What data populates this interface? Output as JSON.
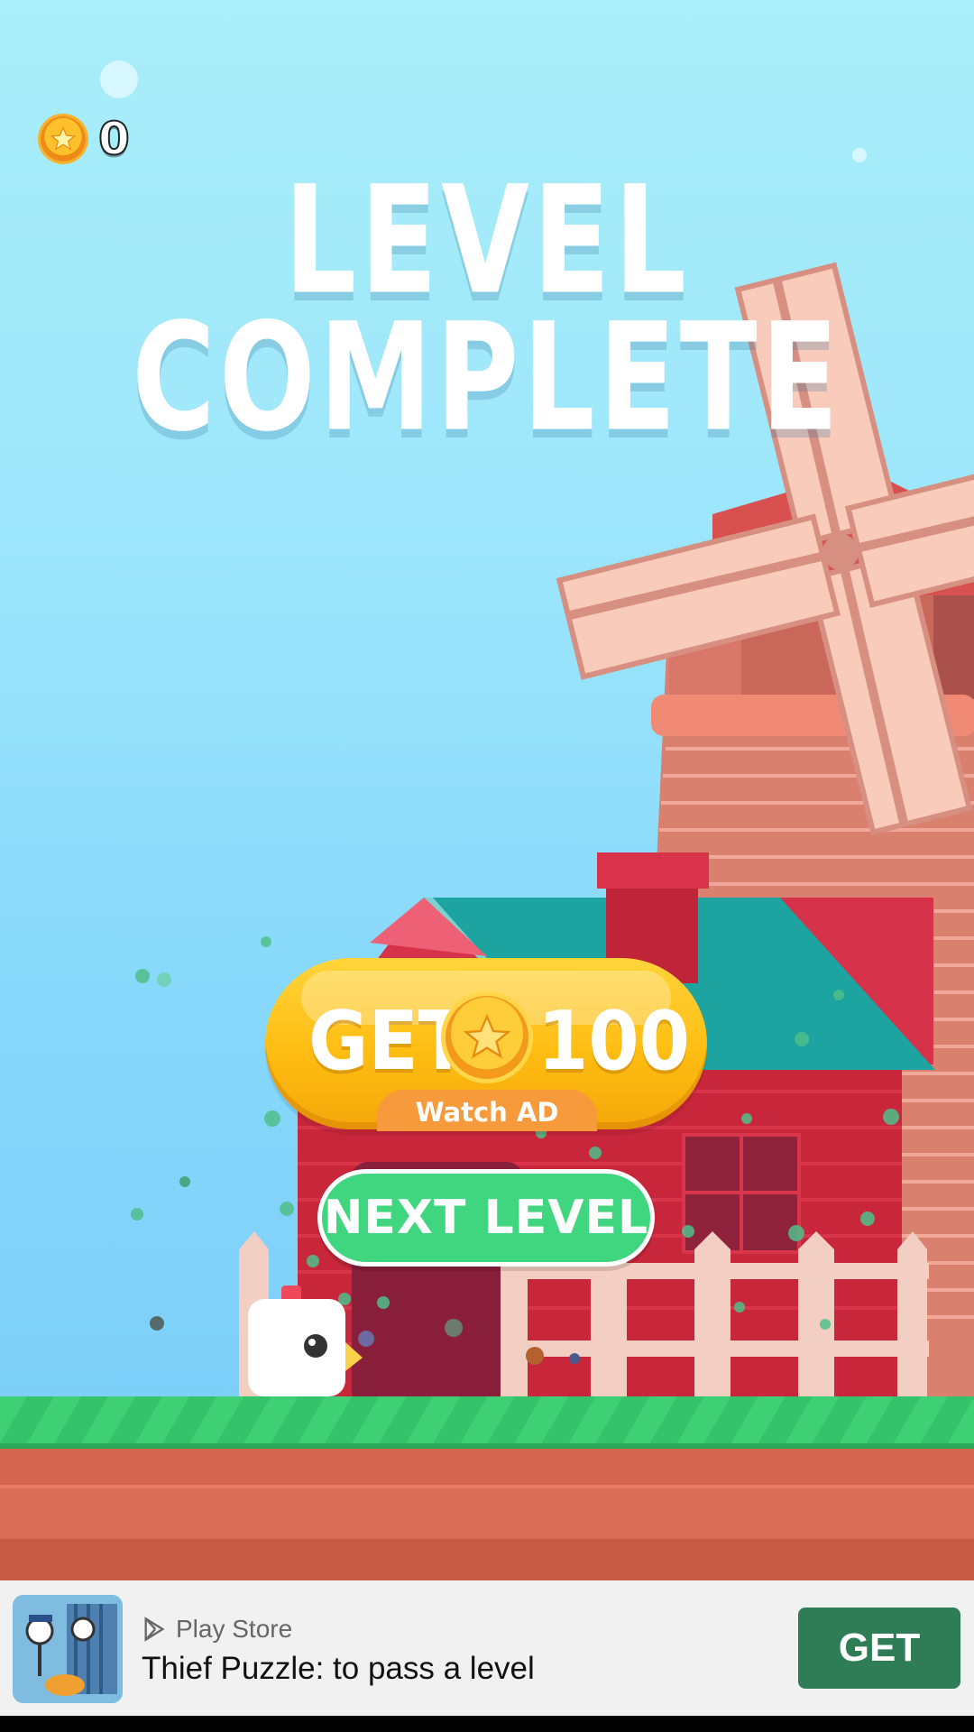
{
  "hud": {
    "coin_count": "0",
    "coin_icon": "star-coin-icon"
  },
  "title": {
    "line1": "LEVEL",
    "line2": "COMPLETE"
  },
  "reward_button": {
    "get_label": "GET",
    "amount": "100",
    "sub_label": "Watch AD"
  },
  "next_button": {
    "label": "NEXT LEVEL"
  },
  "ad": {
    "store": "Play Store",
    "title": "Thief Puzzle: to pass a level",
    "cta": "GET"
  },
  "colors": {
    "sky_top": "#a9eef9",
    "sky_bottom": "#74c8f6",
    "grass": "#3fcf75",
    "dirt": "#d4664f",
    "gold": "#ffbd12",
    "green_button": "#40d67f",
    "ad_cta": "#2e7d57"
  }
}
